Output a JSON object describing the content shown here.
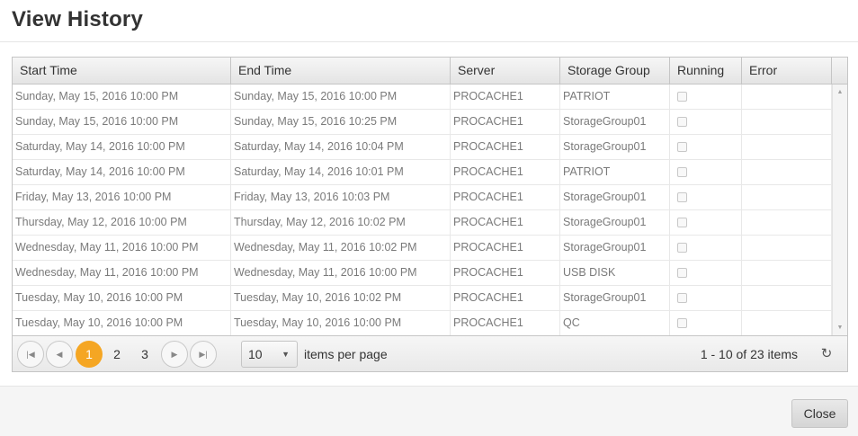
{
  "dialog": {
    "title": "View History",
    "close_label": "Close"
  },
  "grid": {
    "columns": [
      "Start Time",
      "End Time",
      "Server",
      "Storage Group",
      "Running",
      "Error"
    ],
    "rows": [
      {
        "start": "Sunday, May 15, 2016 10:00 PM",
        "end": "Sunday, May 15, 2016 10:00 PM",
        "server": "PROCACHE1",
        "group": "PATRIOT",
        "running": false,
        "error": ""
      },
      {
        "start": "Sunday, May 15, 2016 10:00 PM",
        "end": "Sunday, May 15, 2016 10:25 PM",
        "server": "PROCACHE1",
        "group": "StorageGroup01",
        "running": false,
        "error": ""
      },
      {
        "start": "Saturday, May 14, 2016 10:00 PM",
        "end": "Saturday, May 14, 2016 10:04 PM",
        "server": "PROCACHE1",
        "group": "StorageGroup01",
        "running": false,
        "error": ""
      },
      {
        "start": "Saturday, May 14, 2016 10:00 PM",
        "end": "Saturday, May 14, 2016 10:01 PM",
        "server": "PROCACHE1",
        "group": "PATRIOT",
        "running": false,
        "error": ""
      },
      {
        "start": "Friday, May 13, 2016 10:00 PM",
        "end": "Friday, May 13, 2016 10:03 PM",
        "server": "PROCACHE1",
        "group": "StorageGroup01",
        "running": false,
        "error": ""
      },
      {
        "start": "Thursday, May 12, 2016 10:00 PM",
        "end": "Thursday, May 12, 2016 10:02 PM",
        "server": "PROCACHE1",
        "group": "StorageGroup01",
        "running": false,
        "error": ""
      },
      {
        "start": "Wednesday, May 11, 2016 10:00 PM",
        "end": "Wednesday, May 11, 2016 10:02 PM",
        "server": "PROCACHE1",
        "group": "StorageGroup01",
        "running": false,
        "error": ""
      },
      {
        "start": "Wednesday, May 11, 2016 10:00 PM",
        "end": "Wednesday, May 11, 2016 10:00 PM",
        "server": "PROCACHE1",
        "group": "USB DISK",
        "running": false,
        "error": ""
      },
      {
        "start": "Tuesday, May 10, 2016 10:00 PM",
        "end": "Tuesday, May 10, 2016 10:02 PM",
        "server": "PROCACHE1",
        "group": "StorageGroup01",
        "running": false,
        "error": ""
      },
      {
        "start": "Tuesday, May 10, 2016 10:00 PM",
        "end": "Tuesday, May 10, 2016 10:00 PM",
        "server": "PROCACHE1",
        "group": "QC",
        "running": false,
        "error": ""
      }
    ]
  },
  "pager": {
    "pages": [
      "1",
      "2",
      "3"
    ],
    "current_page": "1",
    "page_size": "10",
    "page_size_label": "items per page",
    "info": "1 - 10 of 23 items",
    "icons": {
      "first": "first-page-icon",
      "prev": "previous-page-icon",
      "next": "next-page-icon",
      "last": "last-page-icon",
      "refresh": "refresh-icon",
      "dropdown": "chevron-down-icon"
    }
  },
  "colors": {
    "accent": "#f5a623",
    "text": "#333333",
    "cell_text": "#7a7a7a"
  }
}
